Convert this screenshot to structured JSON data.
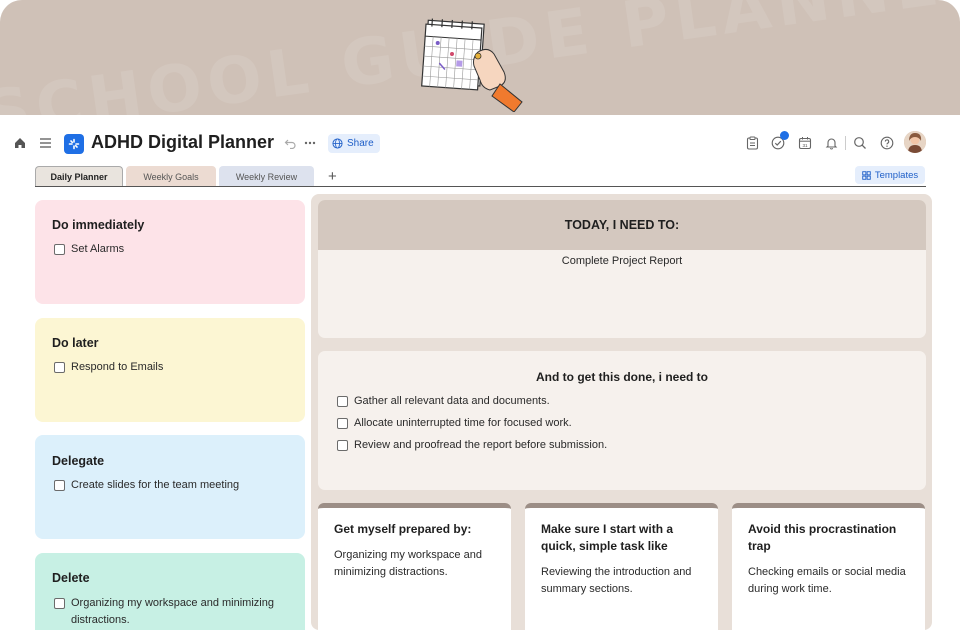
{
  "banner": {
    "watermark": "SCHOOL GUIDE PLANNER"
  },
  "header": {
    "app_title": "ADHD Digital Planner",
    "share_label": "Share",
    "icons": [
      "home-icon",
      "menu-icon",
      "undo-icon",
      "more-icon",
      "globe-icon",
      "clipboard-icon",
      "check-circle-icon",
      "calendar-icon",
      "bell-icon",
      "search-icon",
      "help-icon"
    ],
    "calendar_day": "31"
  },
  "tabs": [
    {
      "label": "Daily Planner",
      "active": true
    },
    {
      "label": "Weekly Goals",
      "active": false
    },
    {
      "label": "Weekly Review",
      "active": false
    }
  ],
  "templates_label": "Templates",
  "quadrants": [
    {
      "title": "Do immediately",
      "color": "#fde3e8",
      "tasks": [
        "Set Alarms"
      ]
    },
    {
      "title": "Do later",
      "color": "#fcf6d3",
      "tasks": [
        "Respond to Emails"
      ]
    },
    {
      "title": "Delegate",
      "color": "#dcf0fb",
      "tasks": [
        "Create slides for the team meeting"
      ]
    },
    {
      "title": "Delete",
      "color": "#c7f0e4",
      "tasks": [
        "Organizing my workspace and minimizing distractions."
      ]
    }
  ],
  "today": {
    "heading": "TODAY, I NEED TO:",
    "task": "Complete Project Report"
  },
  "steps": {
    "heading": "And to get this done, i need to",
    "items": [
      "Gather all relevant data and documents.",
      "Allocate uninterrupted time for focused work.",
      "Review and proofread the report before submission."
    ]
  },
  "bottom_cards": [
    {
      "title": "Get myself prepared by:",
      "body": "Organizing my workspace and minimizing distractions."
    },
    {
      "title": "Make sure I start with a quick, simple task like",
      "body": "Reviewing the introduction and summary sections."
    },
    {
      "title": "Avoid this procrastination trap",
      "body": "Checking emails or social media during work time."
    }
  ],
  "colors": {
    "accent": "#1f6fe5",
    "banner": "#cfc1b7",
    "panel": "#e8dfd8"
  }
}
